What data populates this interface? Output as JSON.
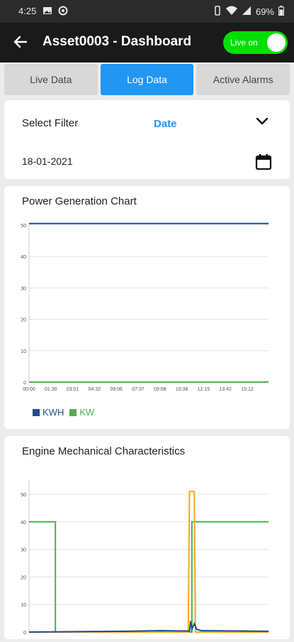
{
  "status_bar": {
    "time": "4:25",
    "battery": "69%",
    "icons_left": [
      "image-icon",
      "vpn-icon"
    ],
    "icons_right": [
      "vibrate-icon",
      "wifi-icon",
      "signal-icon",
      "battery-icon"
    ]
  },
  "app_bar": {
    "back_icon": "arrow-left-icon",
    "title": "Asset0003 - Dashboard",
    "live_toggle_label": "Live on",
    "live_toggle_on": true,
    "toggle_color": "#00e000"
  },
  "tabs": [
    {
      "label": "Live Data",
      "active": false
    },
    {
      "label": "Log Data",
      "active": true
    },
    {
      "label": "Active Alarms",
      "active": false
    }
  ],
  "filter": {
    "label": "Select Filter",
    "value": "Date",
    "date": "18-01-2021"
  },
  "chart_data": [
    {
      "type": "line",
      "title": "Power Generation Chart",
      "x": [
        "00:00",
        "01:30",
        "03:01",
        "04:32",
        "06:06",
        "07:37",
        "09:08",
        "10:38",
        "12:15",
        "13:42",
        "15:12"
      ],
      "yticks": [
        0,
        10,
        20,
        30,
        40,
        50
      ],
      "ylim": [
        0,
        50
      ],
      "series": [
        {
          "name": "KWH",
          "color": "#1f4e8c",
          "values": [
            50.5,
            50.5,
            50.5,
            50.5,
            50.5,
            50.5,
            50.5,
            50.5,
            50.5,
            50.5,
            50.5
          ]
        },
        {
          "name": "KW",
          "color": "#4caf50",
          "values": [
            0,
            0,
            0,
            0,
            0,
            0,
            0,
            0,
            0,
            0,
            0
          ]
        }
      ],
      "legend": "bottom-left",
      "grid": true
    },
    {
      "type": "line",
      "title": "Engine Mechanical Characteristics",
      "yticks": [
        0,
        10,
        20,
        30,
        40,
        50
      ],
      "ylim": [
        0,
        50
      ],
      "grid": true,
      "series": [
        {
          "color": "#4caf50",
          "values": [
            [
              0,
              40
            ],
            [
              0.11,
              40
            ],
            [
              0.11,
              0
            ],
            [
              0.68,
              0
            ],
            [
              0.68,
              40
            ],
            [
              1,
              40
            ]
          ]
        },
        {
          "color": "#f5a623",
          "values": [
            [
              0,
              0
            ],
            [
              0.665,
              0
            ],
            [
              0.67,
              51
            ],
            [
              0.69,
              51
            ],
            [
              0.695,
              0
            ],
            [
              1,
              0
            ]
          ]
        },
        {
          "color": "#1f4e8c",
          "values": [
            [
              0,
              0
            ],
            [
              0.4,
              0.3
            ],
            [
              0.55,
              0.5
            ],
            [
              0.67,
              0.4
            ],
            [
              0.675,
              4
            ],
            [
              0.68,
              1
            ],
            [
              0.69,
              3
            ],
            [
              0.7,
              1
            ],
            [
              0.72,
              0.5
            ],
            [
              1,
              0.3
            ]
          ]
        }
      ]
    }
  ]
}
